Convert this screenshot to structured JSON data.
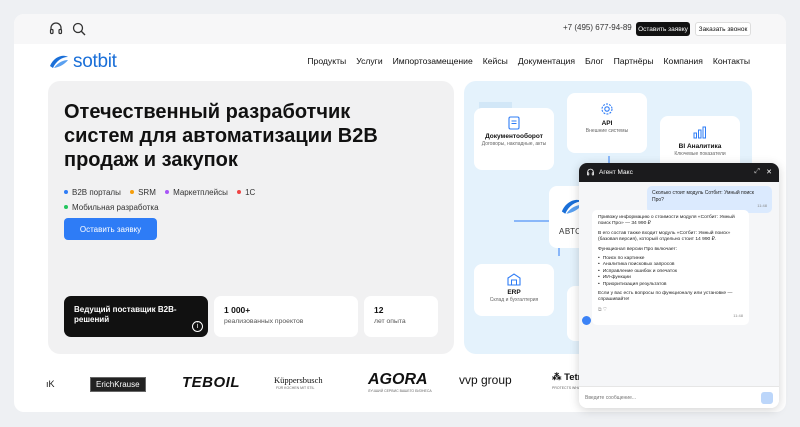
{
  "topbar": {
    "phone": "+7 (495) 677-94-89",
    "request_btn": "Оставить заявку",
    "callback_btn": "Заказать звонок"
  },
  "brand": {
    "name": "sotbit",
    "color": "#1a6fd8"
  },
  "nav": [
    "Продукты",
    "Услуги",
    "Импортозамещение",
    "Кейсы",
    "Документация",
    "Блог",
    "Партнёры",
    "Компания",
    "Контакты"
  ],
  "hero": {
    "title": "Отечественный разработчик систем для автоматизации B2B продаж и закупок",
    "tags": [
      {
        "label": "B2B порталы",
        "color": "#2e7cf6"
      },
      {
        "label": "SRM",
        "color": "#f59e0b"
      },
      {
        "label": "Маркетплейсы",
        "color": "#a855f7"
      },
      {
        "label": "1С",
        "color": "#ef4444"
      },
      {
        "label": "Мобильная разработка",
        "color": "#22c55e"
      }
    ],
    "cta": "Оставить заявку",
    "stat_main": "Ведущий поставщик B2B-решений",
    "stats": [
      {
        "value": "1 000+",
        "label": "реализованных проектов"
      },
      {
        "value": "12",
        "label": "лет опыта"
      }
    ]
  },
  "diagram": {
    "nodes": {
      "docflow": {
        "title": "Документооборот",
        "sub": "Договоры, накладные, акты"
      },
      "api": {
        "title": "API",
        "sub": "Внешние системы"
      },
      "bi": {
        "title": "BI Аналитика",
        "sub": "Ключевые показатели"
      },
      "erp": {
        "title": "ERP",
        "sub": "Склад и бухгалтерия"
      },
      "center": {
        "title": "АВТО"
      }
    }
  },
  "chat": {
    "title": "Агент Макс",
    "user_msg": "Сколько стоит модуль Сотбит: Умный поиск Про?",
    "user_time": "11:48",
    "bot_p1": "Привожу информацию о стоимости модуля «Сотбит: Умный поиск Про» — 34 990 ₽",
    "bot_p2": "В его состав также входит модуль «Сотбит: Умный поиск» (базовая версия), который отдельно стоит 14 990 ₽.",
    "bot_p3": "Функционал версии Про включает:",
    "features": [
      "Поиск по картинке",
      "Аналитика поисковых запросов",
      "Исправление ошибок и опечаток",
      "ИИ-функции",
      "Приоритизация результатов"
    ],
    "bot_p4": "Если у вас есть вопросы по функционалу или установке — спрашивайте!",
    "bot_time": "11:48",
    "input_placeholder": "Введите сообщение..."
  },
  "partners": [
    "ErichKrause",
    "TEBOIL",
    "Küppersbusch",
    "AGORA",
    "vvp group",
    "Tetra Pak"
  ],
  "partner_slogans": {
    "kuppersbusch": "FÜR KOCHEN MIT STIL",
    "agora": "ЛУЧШИЙ СЕРВИС ВАШЕГО БИЗНЕСА",
    "tetra": "PROTECTS WHAT'S GOOD"
  }
}
